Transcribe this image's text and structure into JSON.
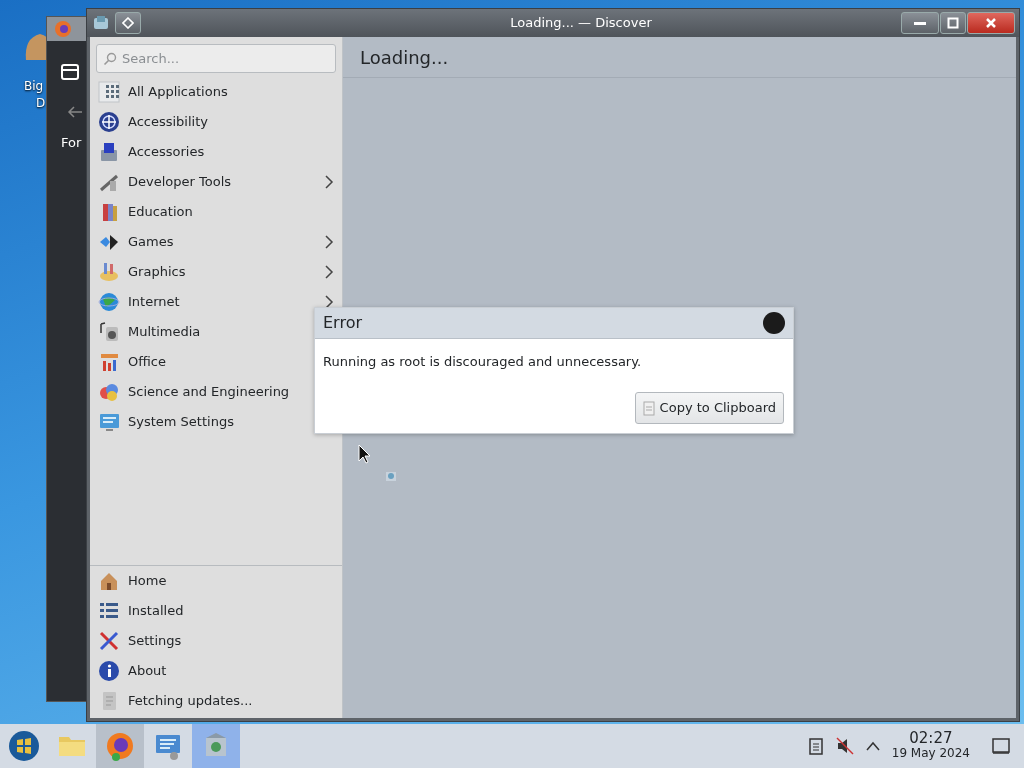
{
  "desktop_icon": {
    "label_lines": [
      "Big",
      "D"
    ]
  },
  "background_window": {
    "text": "For"
  },
  "window": {
    "title": "Loading... — Discover"
  },
  "search": {
    "placeholder": "Search..."
  },
  "categories": [
    {
      "label": "All Applications",
      "has_children": false
    },
    {
      "label": "Accessibility",
      "has_children": false
    },
    {
      "label": "Accessories",
      "has_children": false
    },
    {
      "label": "Developer Tools",
      "has_children": true
    },
    {
      "label": "Education",
      "has_children": false
    },
    {
      "label": "Games",
      "has_children": true
    },
    {
      "label": "Graphics",
      "has_children": true
    },
    {
      "label": "Internet",
      "has_children": true
    },
    {
      "label": "Multimedia",
      "has_children": false
    },
    {
      "label": "Office",
      "has_children": false
    },
    {
      "label": "Science and Engineering",
      "has_children": false
    },
    {
      "label": "System Settings",
      "has_children": false
    }
  ],
  "footer_items": [
    {
      "label": "Home"
    },
    {
      "label": "Installed"
    },
    {
      "label": "Settings"
    },
    {
      "label": "About"
    },
    {
      "label": "Fetching updates..."
    }
  ],
  "page": {
    "heading": "Loading..."
  },
  "dialog": {
    "title": "Error",
    "message": "Running as root is discouraged and unnecessary.",
    "button": "Copy to Clipboard"
  },
  "taskbar": {
    "apps": [
      {
        "kind": "start",
        "selected": false,
        "hovered": false
      },
      {
        "kind": "folder",
        "selected": false,
        "hovered": false
      },
      {
        "kind": "browser",
        "selected": false,
        "hovered": true
      },
      {
        "kind": "monitor",
        "selected": false,
        "hovered": false
      },
      {
        "kind": "store",
        "selected": true,
        "hovered": false
      }
    ]
  },
  "clock": {
    "time": "02:27",
    "date": "19 May 2024"
  }
}
